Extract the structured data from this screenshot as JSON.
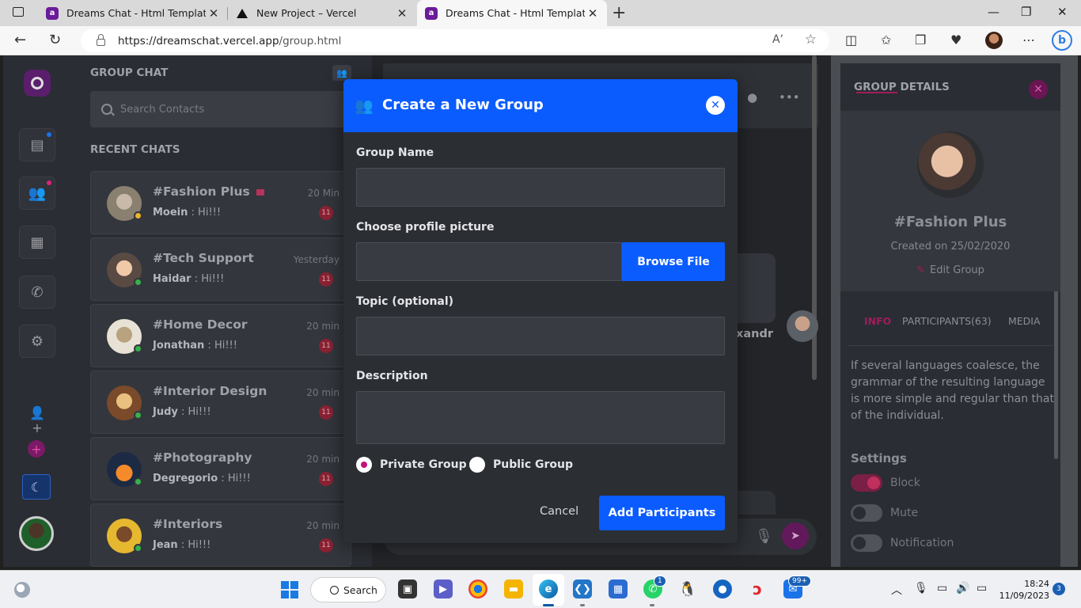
{
  "browser": {
    "tabs": [
      {
        "label": "Dreams Chat - Html Template",
        "icon": "dreamschat-favicon"
      },
      {
        "label": "New Project – Vercel",
        "icon": "vercel-favicon"
      },
      {
        "label": "Dreams Chat - Html Template",
        "icon": "dreamschat-favicon",
        "active": true
      }
    ],
    "new_tab": "+",
    "url_host": "https://dreamschat.vercel.app",
    "url_path": "/group.html",
    "window_controls": {
      "minimize": "—",
      "maximize": "❐",
      "close": "✕"
    }
  },
  "rail": {
    "items": [
      "chat-icon",
      "group-icon",
      "status-icon",
      "call-icon",
      "settings-icon"
    ],
    "dot_colors": {
      "chat": "#1a73e8",
      "group": "#e0227a"
    }
  },
  "chatlist": {
    "title": "GROUP CHAT",
    "search_placeholder": "Search Contacts",
    "recent_title": "RECENT CHATS",
    "chats": [
      {
        "name": "#Fashion Plus",
        "sender": "Moein",
        "message": " : Hi!!!",
        "time": "20 Min",
        "unread": "11",
        "locked": true,
        "status_color": "#f0b429"
      },
      {
        "name": "#Tech Support",
        "sender": "Haidar",
        "message": " : Hi!!!",
        "time": "Yesterday",
        "unread": "11",
        "status_color": "#34b34a"
      },
      {
        "name": "#Home Decor",
        "sender": "Jonathan",
        "message": " : Hi!!!",
        "time": "20 min",
        "unread": "11",
        "status_color": "#34b34a"
      },
      {
        "name": "#Interior Design",
        "sender": "Judy",
        "message": " : Hi!!!",
        "time": "20 min",
        "unread": "11",
        "status_color": "#34b34a"
      },
      {
        "name": "#Photography",
        "sender": "Degregorio",
        "message": " : Hi!!!",
        "time": "20 min",
        "unread": "11",
        "status_color": "#34b34a"
      },
      {
        "name": "#Interiors",
        "sender": "Jean",
        "message": " : Hi!!!",
        "time": "20 min",
        "unread": "11",
        "status_color": "#34b34a"
      }
    ]
  },
  "chat": {
    "visible_name_fragment": "xandr"
  },
  "details": {
    "title": "GROUP DETAILS",
    "group_name": "#Fashion Plus",
    "created": "Created on 25/02/2020",
    "edit": "Edit Group",
    "tabs": [
      "INFO",
      "PARTICIPANTS(63)",
      "MEDIA"
    ],
    "info": "If several languages coalesce, the grammar of the resulting language is more simple and regular than that of the individual.",
    "settings_title": "Settings",
    "toggles": [
      {
        "label": "Block",
        "on": true
      },
      {
        "label": "Mute",
        "on": false
      },
      {
        "label": "Notification",
        "on": false
      }
    ]
  },
  "modal": {
    "title": "Create a New Group",
    "group_name_label": "Group Name",
    "group_name_value": "",
    "profile_label": "Choose profile picture",
    "browse": "Browse File",
    "topic_label": "Topic (optional)",
    "topic_value": "",
    "description_label": "Description",
    "description_value": "",
    "private": "Private Group",
    "public": "Public Group",
    "selected": "Private Group",
    "cancel": "Cancel",
    "add": "Add Participants",
    "accent": "#0a5cff"
  },
  "taskbar": {
    "search": "Search",
    "whatsapp_badge": "1",
    "mail_badge": "99+",
    "time": "18:24",
    "date": "11/09/2023",
    "notifications": "3"
  }
}
